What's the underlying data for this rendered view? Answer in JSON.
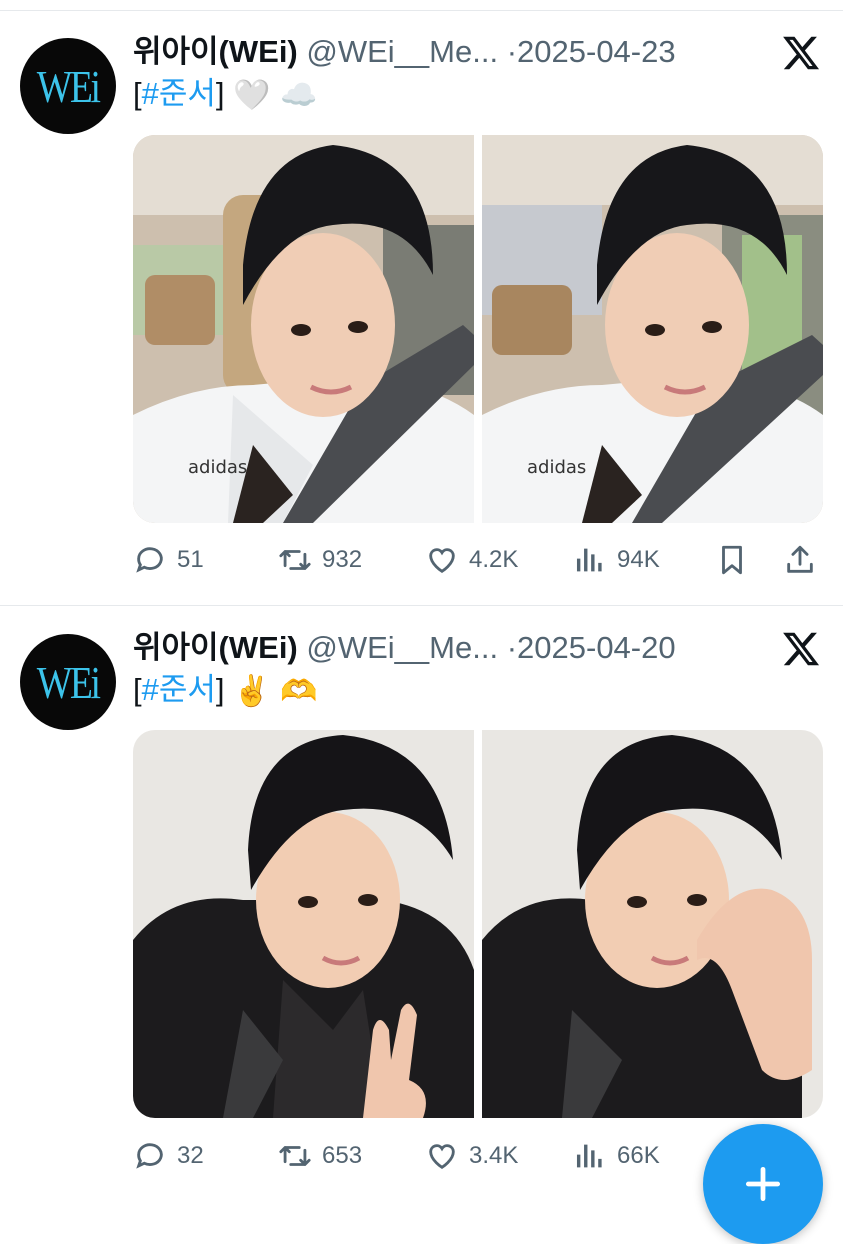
{
  "tweets": [
    {
      "avatar_text": "WEi",
      "name": "위아이(WEi)",
      "handle": "@WEi__Me...",
      "separator": "·",
      "date": "2025-04-23",
      "text_open": "[",
      "hashtag": "#준서",
      "text_close": "]",
      "emoji": "🤍 ☁️",
      "photos": [
        "selfie in car, white adidas track jacket",
        "selfie in car, white adidas track jacket"
      ],
      "replies": "51",
      "retweets": "932",
      "likes": "4.2K",
      "views": "94K"
    },
    {
      "avatar_text": "WEi",
      "name": "위아이(WEi)",
      "handle": "@WEi__Me...",
      "separator": "·",
      "date": "2025-04-20",
      "text_open": "[",
      "hashtag": "#준서",
      "text_close": "]",
      "emoji": "✌️ 🫶",
      "photos": [
        "selfie in black leather jacket with peace sign",
        "selfie in black leather jacket with heart hand"
      ],
      "replies": "32",
      "retweets": "653",
      "likes": "3.4K",
      "views": "66K"
    }
  ],
  "colors": {
    "accent": "#1d9bf0",
    "secondary_text": "#536471",
    "primary_text": "#0f1419",
    "avatar_bg": "#080808",
    "avatar_logo": "#3cc3ea"
  },
  "icons": [
    "reply-icon",
    "retweet-icon",
    "like-icon",
    "views-icon",
    "bookmark-icon",
    "share-icon",
    "x-logo-icon",
    "plus-icon"
  ]
}
